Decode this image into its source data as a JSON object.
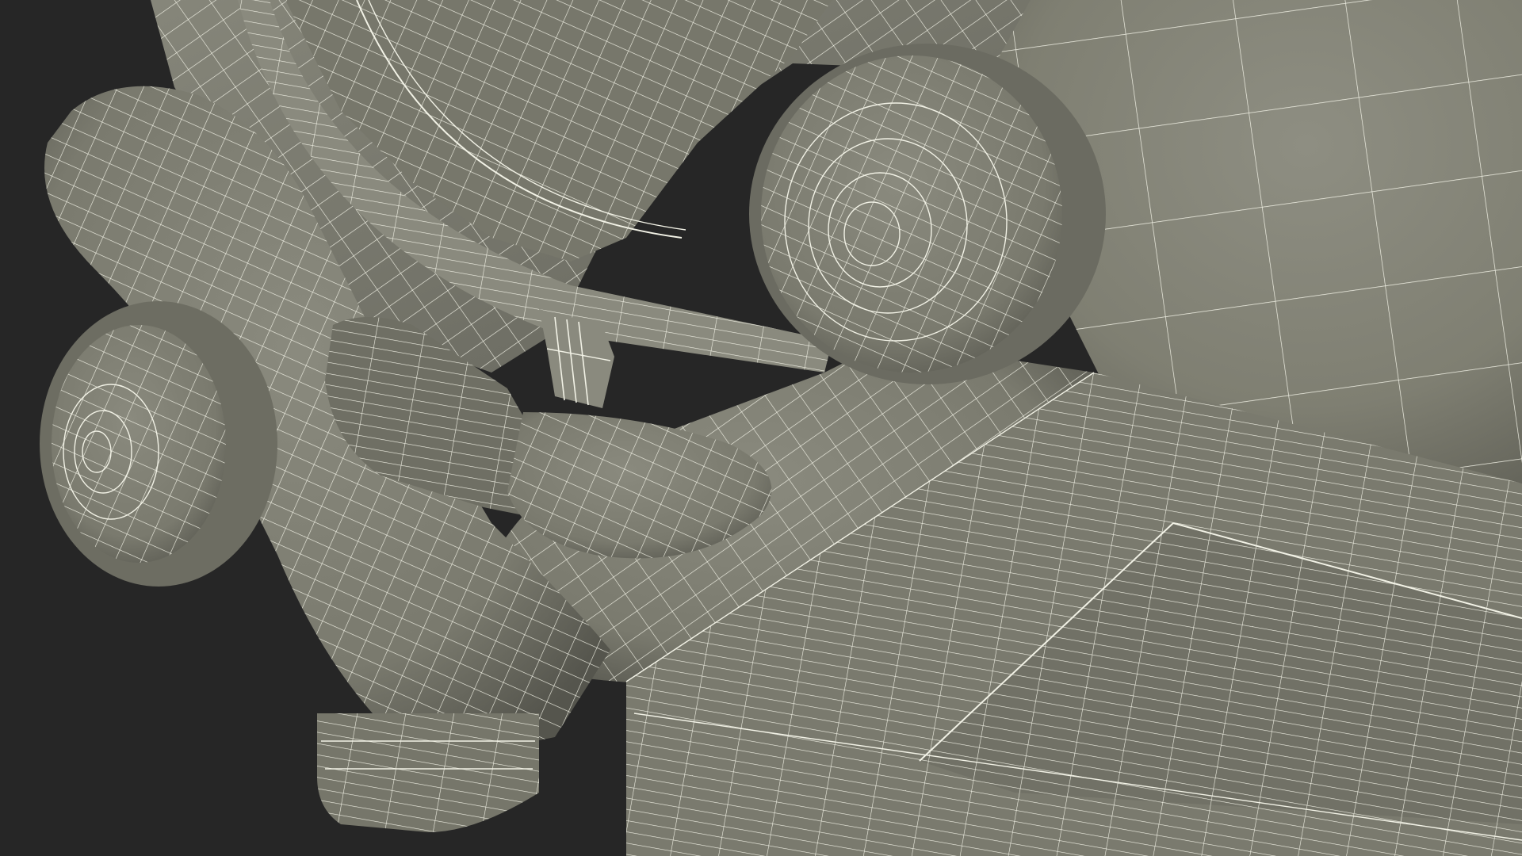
{
  "scene": {
    "background_color": "#262626",
    "surface_color": "#7f7f72",
    "surface_shadow_color": "#5c5c53",
    "surface_highlight_color": "#8e8e82",
    "wire_color": "#f2f2e6"
  }
}
